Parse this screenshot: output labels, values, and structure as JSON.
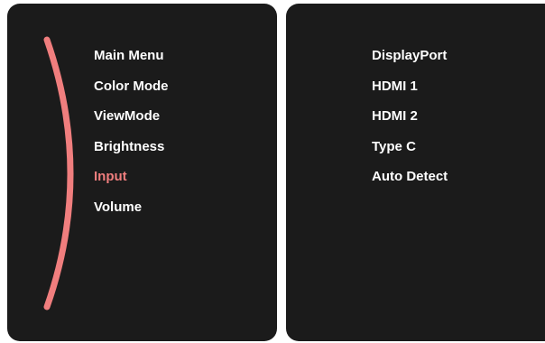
{
  "colors": {
    "panel_bg": "#1b1b1b",
    "text": "#ffffff",
    "accent": "#f07e7e"
  },
  "main_menu": {
    "items": [
      {
        "label": "Main Menu",
        "active": false
      },
      {
        "label": "Color Mode",
        "active": false
      },
      {
        "label": "ViewMode",
        "active": false
      },
      {
        "label": "Brightness",
        "active": false
      },
      {
        "label": "Input",
        "active": true
      },
      {
        "label": "Volume",
        "active": false
      }
    ]
  },
  "input_submenu": {
    "options": [
      {
        "label": "DisplayPort"
      },
      {
        "label": "HDMI 1"
      },
      {
        "label": "HDMI 2"
      },
      {
        "label": "Type C"
      },
      {
        "label": "Auto Detect"
      }
    ]
  },
  "scroll_indicator": {
    "icon": "curved-scroll-indicator-icon"
  }
}
